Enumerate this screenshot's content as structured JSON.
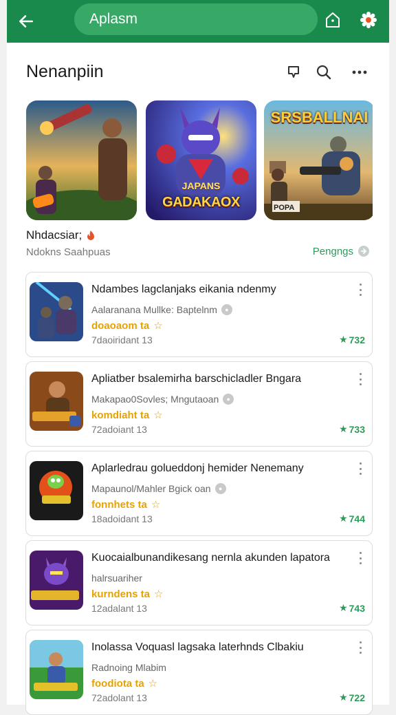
{
  "topbar": {
    "search_text": "Aplasm"
  },
  "header": {
    "title": "Nenanpiin"
  },
  "tiles": [
    {
      "caption": "",
      "badge": ""
    },
    {
      "caption": "GADAKAOX",
      "small": "JAPANS"
    },
    {
      "caption": "SRSBALLNAI",
      "small": "POPA"
    }
  ],
  "section": {
    "title": "Nhdacsiar;",
    "subtitle": "Ndokns Saahpuas",
    "link": "Pengngs"
  },
  "apps": [
    {
      "title": "Ndambes lagclanjaks eikania ndenmy",
      "dev": "Aalaranana Mullke: Baptelnm",
      "rating": "doaoaom ta",
      "size": "7daoiridant 13",
      "score": "732"
    },
    {
      "title": "Apliatber bsalemirha barschicladler Bngara",
      "dev": "Makapao0Sovles; Mngutaoan",
      "rating": "komdiaht ta",
      "size": "72adoiant 13",
      "score": "733"
    },
    {
      "title": "Aplarledrau golueddonj hemider Nenemany",
      "dev": "Mapaunol/Mahler Bgick oan",
      "rating": "fonnhets ta",
      "size": "18adoidant 13",
      "score": "744"
    },
    {
      "title": "Kuocaialbunandikesang nernla akunden lapatora",
      "dev": "halrsuariher",
      "rating": "kurndens ta",
      "size": "12adalant 13",
      "score": "743"
    },
    {
      "title": "Inolassa Voquasl lagsaka laterhnds Clbakiu",
      "dev": "Radnoing Mlabim",
      "rating": "foodiota ta",
      "size": "72adolant 13",
      "score": "722"
    }
  ]
}
